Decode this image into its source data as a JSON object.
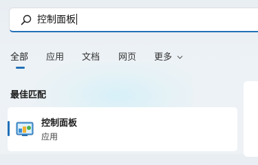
{
  "search": {
    "query": "控制面板"
  },
  "tabs": [
    {
      "label": "全部",
      "active": true
    },
    {
      "label": "应用"
    },
    {
      "label": "文档"
    },
    {
      "label": "网页"
    },
    {
      "label": "更多"
    }
  ],
  "section": {
    "best_match": "最佳匹配"
  },
  "best_result": {
    "title": "控制面板",
    "subtitle": "应用",
    "icon": "control-panel-icon"
  },
  "colors": {
    "accent": "#1f6fb7",
    "background": "#edf2f6",
    "card": "#ffffff"
  }
}
